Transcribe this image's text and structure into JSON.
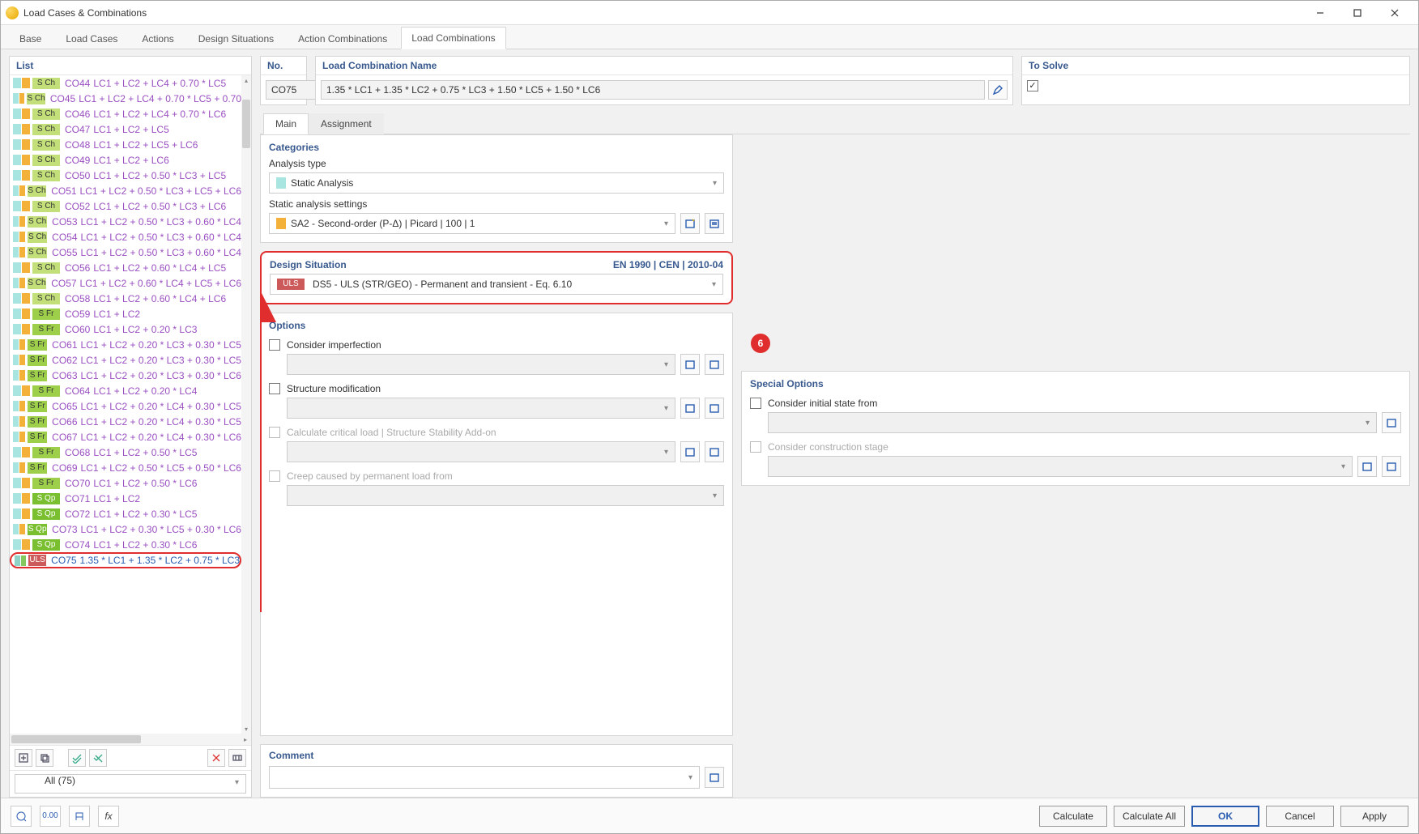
{
  "window": {
    "title": "Load Cases & Combinations"
  },
  "tabs": [
    "Base",
    "Load Cases",
    "Actions",
    "Design Situations",
    "Action Combinations",
    "Load Combinations"
  ],
  "activeTab": 5,
  "filter": {
    "label": "All (75)"
  },
  "no_panel": {
    "header": "No.",
    "value": "CO75"
  },
  "name_panel": {
    "header": "Load Combination Name",
    "value": "1.35 * LC1 + 1.35 * LC2 + 0.75 * LC3 + 1.50 * LC5 + 1.50 * LC6"
  },
  "tosolve": {
    "header": "To Solve",
    "checked": true
  },
  "subtabs": [
    "Main",
    "Assignment"
  ],
  "activeSubtab": 0,
  "categories": {
    "header": "Categories",
    "analysis_type_label": "Analysis type",
    "analysis_type_value": "Static Analysis",
    "static_settings_label": "Static analysis settings",
    "static_settings_value": "SA2 - Second-order (P-Δ) | Picard | 100 | 1"
  },
  "design_situation": {
    "header": "Design Situation",
    "standard": "EN 1990 | CEN | 2010-04",
    "value": "DS5 - ULS (STR/GEO) - Permanent and transient - Eq. 6.10",
    "badge": "ULS",
    "callout": "6"
  },
  "options": {
    "header": "Options",
    "imperfection": "Consider imperfection",
    "structure_mod": "Structure modification",
    "critical_load": "Calculate critical load | Structure Stability Add-on",
    "creep": "Creep caused by permanent load from"
  },
  "special": {
    "header": "Special Options",
    "initial_state": "Consider initial state from",
    "construction_stage": "Consider construction stage"
  },
  "comment": {
    "header": "Comment"
  },
  "footer": {
    "calculate": "Calculate",
    "calculate_all": "Calculate All",
    "ok": "OK",
    "cancel": "Cancel",
    "apply": "Apply"
  },
  "list": {
    "header": "List",
    "rows": [
      {
        "badge": "S Ch",
        "bcls": "sch",
        "sw1": "sw-cyan",
        "sw2": "sw-orange",
        "code": "CO44",
        "text": "LC1 + LC2 + LC4 + 0.70 * LC5"
      },
      {
        "badge": "S Ch",
        "bcls": "sch",
        "sw1": "sw-cyan",
        "sw2": "sw-orange",
        "code": "CO45",
        "text": "LC1 + LC2 + LC4 + 0.70 * LC5 + 0.70"
      },
      {
        "badge": "S Ch",
        "bcls": "sch",
        "sw1": "sw-cyan",
        "sw2": "sw-orange",
        "code": "CO46",
        "text": "LC1 + LC2 + LC4 + 0.70 * LC6"
      },
      {
        "badge": "S Ch",
        "bcls": "sch",
        "sw1": "sw-cyan",
        "sw2": "sw-orange",
        "code": "CO47",
        "text": "LC1 + LC2 + LC5"
      },
      {
        "badge": "S Ch",
        "bcls": "sch",
        "sw1": "sw-cyan",
        "sw2": "sw-orange",
        "code": "CO48",
        "text": "LC1 + LC2 + LC5 + LC6"
      },
      {
        "badge": "S Ch",
        "bcls": "sch",
        "sw1": "sw-cyan",
        "sw2": "sw-orange",
        "code": "CO49",
        "text": "LC1 + LC2 + LC6"
      },
      {
        "badge": "S Ch",
        "bcls": "sch",
        "sw1": "sw-cyan",
        "sw2": "sw-orange",
        "code": "CO50",
        "text": "LC1 + LC2 + 0.50 * LC3 + LC5"
      },
      {
        "badge": "S Ch",
        "bcls": "sch",
        "sw1": "sw-cyan",
        "sw2": "sw-orange",
        "code": "CO51",
        "text": "LC1 + LC2 + 0.50 * LC3 + LC5 + LC6"
      },
      {
        "badge": "S Ch",
        "bcls": "sch",
        "sw1": "sw-cyan",
        "sw2": "sw-orange",
        "code": "CO52",
        "text": "LC1 + LC2 + 0.50 * LC3 + LC6"
      },
      {
        "badge": "S Ch",
        "bcls": "sch",
        "sw1": "sw-cyan",
        "sw2": "sw-orange",
        "code": "CO53",
        "text": "LC1 + LC2 + 0.50 * LC3 + 0.60 * LC4"
      },
      {
        "badge": "S Ch",
        "bcls": "sch",
        "sw1": "sw-cyan",
        "sw2": "sw-orange",
        "code": "CO54",
        "text": "LC1 + LC2 + 0.50 * LC3 + 0.60 * LC4"
      },
      {
        "badge": "S Ch",
        "bcls": "sch",
        "sw1": "sw-cyan",
        "sw2": "sw-orange",
        "code": "CO55",
        "text": "LC1 + LC2 + 0.50 * LC3 + 0.60 * LC4"
      },
      {
        "badge": "S Ch",
        "bcls": "sch",
        "sw1": "sw-cyan",
        "sw2": "sw-orange",
        "code": "CO56",
        "text": "LC1 + LC2 + 0.60 * LC4 + LC5"
      },
      {
        "badge": "S Ch",
        "bcls": "sch",
        "sw1": "sw-cyan",
        "sw2": "sw-orange",
        "code": "CO57",
        "text": "LC1 + LC2 + 0.60 * LC4 + LC5 + LC6"
      },
      {
        "badge": "S Ch",
        "bcls": "sch",
        "sw1": "sw-cyan",
        "sw2": "sw-orange",
        "code": "CO58",
        "text": "LC1 + LC2 + 0.60 * LC4 + LC6"
      },
      {
        "badge": "S Fr",
        "bcls": "sfr",
        "sw1": "sw-cyan",
        "sw2": "sw-orange",
        "code": "CO59",
        "text": "LC1 + LC2"
      },
      {
        "badge": "S Fr",
        "bcls": "sfr",
        "sw1": "sw-cyan",
        "sw2": "sw-orange",
        "code": "CO60",
        "text": "LC1 + LC2 + 0.20 * LC3"
      },
      {
        "badge": "S Fr",
        "bcls": "sfr",
        "sw1": "sw-cyan",
        "sw2": "sw-orange",
        "code": "CO61",
        "text": "LC1 + LC2 + 0.20 * LC3 + 0.30 * LC5"
      },
      {
        "badge": "S Fr",
        "bcls": "sfr",
        "sw1": "sw-cyan",
        "sw2": "sw-orange",
        "code": "CO62",
        "text": "LC1 + LC2 + 0.20 * LC3 + 0.30 * LC5"
      },
      {
        "badge": "S Fr",
        "bcls": "sfr",
        "sw1": "sw-cyan",
        "sw2": "sw-orange",
        "code": "CO63",
        "text": "LC1 + LC2 + 0.20 * LC3 + 0.30 * LC6"
      },
      {
        "badge": "S Fr",
        "bcls": "sfr",
        "sw1": "sw-cyan",
        "sw2": "sw-orange",
        "code": "CO64",
        "text": "LC1 + LC2 + 0.20 * LC4"
      },
      {
        "badge": "S Fr",
        "bcls": "sfr",
        "sw1": "sw-cyan",
        "sw2": "sw-orange",
        "code": "CO65",
        "text": "LC1 + LC2 + 0.20 * LC4 + 0.30 * LC5"
      },
      {
        "badge": "S Fr",
        "bcls": "sfr",
        "sw1": "sw-cyan",
        "sw2": "sw-orange",
        "code": "CO66",
        "text": "LC1 + LC2 + 0.20 * LC4 + 0.30 * LC5"
      },
      {
        "badge": "S Fr",
        "bcls": "sfr",
        "sw1": "sw-cyan",
        "sw2": "sw-orange",
        "code": "CO67",
        "text": "LC1 + LC2 + 0.20 * LC4 + 0.30 * LC6"
      },
      {
        "badge": "S Fr",
        "bcls": "sfr",
        "sw1": "sw-cyan",
        "sw2": "sw-orange",
        "code": "CO68",
        "text": "LC1 + LC2 + 0.50 * LC5"
      },
      {
        "badge": "S Fr",
        "bcls": "sfr",
        "sw1": "sw-cyan",
        "sw2": "sw-orange",
        "code": "CO69",
        "text": "LC1 + LC2 + 0.50 * LC5 + 0.50 * LC6"
      },
      {
        "badge": "S Fr",
        "bcls": "sfr",
        "sw1": "sw-cyan",
        "sw2": "sw-orange",
        "code": "CO70",
        "text": "LC1 + LC2 + 0.50 * LC6"
      },
      {
        "badge": "S Qp",
        "bcls": "sqp",
        "sw1": "sw-cyan",
        "sw2": "sw-orange",
        "code": "CO71",
        "text": "LC1 + LC2"
      },
      {
        "badge": "S Qp",
        "bcls": "sqp",
        "sw1": "sw-cyan",
        "sw2": "sw-orange",
        "code": "CO72",
        "text": "LC1 + LC2 + 0.30 * LC5"
      },
      {
        "badge": "S Qp",
        "bcls": "sqp",
        "sw1": "sw-cyan",
        "sw2": "sw-orange",
        "code": "CO73",
        "text": "LC1 + LC2 + 0.30 * LC5 + 0.30 * LC6"
      },
      {
        "badge": "S Qp",
        "bcls": "sqp",
        "sw1": "sw-cyan",
        "sw2": "sw-orange",
        "code": "CO74",
        "text": "LC1 + LC2 + 0.30 * LC6"
      },
      {
        "badge": "ULS",
        "bcls": "uls",
        "sw1": "sw-cyan",
        "sw2": "sw-green",
        "code": "CO75",
        "text": "1.35 * LC1 + 1.35 * LC2 + 0.75 * LC3",
        "selected": true
      }
    ]
  }
}
